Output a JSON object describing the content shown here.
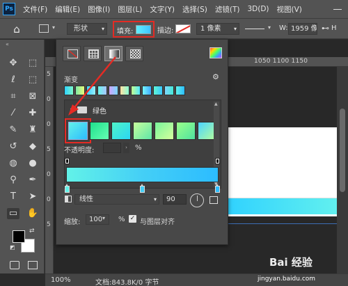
{
  "menubar": {
    "logo": "Ps",
    "items": [
      "文件(F)",
      "编辑(E)",
      "图像(I)",
      "图层(L)",
      "文字(Y)",
      "选择(S)",
      "滤镜(T)",
      "3D(D)",
      "视图(V)"
    ]
  },
  "options": {
    "mode_value": "形状",
    "fill_label": "填充:",
    "fill_colors": [
      "#60f0ff",
      "#3fc3ff"
    ],
    "stroke_label": "描边:",
    "stroke_size": "1 像素",
    "w_label": "W:",
    "w_value": "1959 像",
    "h_label": "H"
  },
  "canvas": {
    "ruler_top_label": "1050   1100   1150",
    "ruler_left_nums": [
      "5",
      "0",
      "0",
      "5",
      "0",
      "0",
      "5"
    ]
  },
  "popup": {
    "gradient_title": "渐变",
    "folder_label": "绿色",
    "opacity_label": "不透明度:",
    "opacity_unit": "%",
    "style_value": "线性",
    "angle_value": "90",
    "scale_label": "缩放:",
    "scale_value": "100",
    "scale_unit": "%",
    "align_label": "与图层对齐",
    "recent_swatches": [
      [
        "#2ed3ff",
        "#7ef7c8"
      ],
      [
        "#7fe7a4",
        "#e8ff7a"
      ],
      [
        "#3ad3ff",
        "#98f0ff"
      ],
      [
        "#6af7ea",
        "#a9c2ff"
      ],
      [
        "#cfa5ff",
        "#7ad7ff"
      ],
      [
        "#ffe0a3",
        "#8affd4"
      ],
      [
        "#c4ff8f",
        "#52e7ff"
      ],
      [
        "#76f7ff",
        "#3fa9ff"
      ],
      [
        "#5ef5d5",
        "#3bc8ff"
      ],
      [
        "#7fd7ff",
        "#46e8d6"
      ],
      [
        "#62f2e8",
        "#2cbcff"
      ]
    ],
    "preset_swatches": [
      [
        "#62f2e8",
        "#2cbcff"
      ],
      [
        "#1fe08c",
        "#65ffb3"
      ],
      [
        "#4ef3c8",
        "#2bd7f3"
      ],
      [
        "#c8ff9c",
        "#5fe6a8"
      ],
      [
        "#78f59b",
        "#d5ff9d"
      ],
      [
        "#9bff8a",
        "#4ee3a0"
      ],
      [
        "#4bd4ff",
        "#b8ff9a"
      ]
    ]
  },
  "status": {
    "zoom": "100%",
    "doc_info": "文档:843.8K/0 字节"
  },
  "watermark": {
    "logo": "Bai 经验",
    "url": "jingyan.baidu.com"
  }
}
